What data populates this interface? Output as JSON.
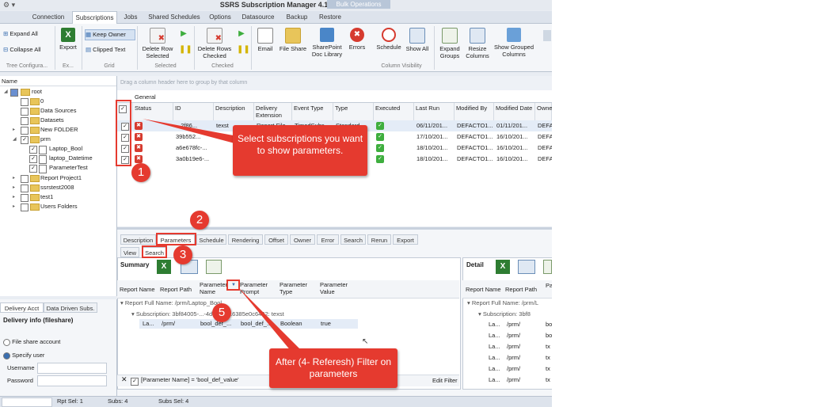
{
  "window": {
    "title": "SSRS Subscription Manager 4.10",
    "bulk_label": "Bulk Operations",
    "icon": "app-icon"
  },
  "menu_tabs": [
    "Connection",
    "Subscriptions",
    "Jobs",
    "Shared Schedules",
    "Options",
    "Datasource",
    "Backup",
    "Restore"
  ],
  "ribbon": {
    "expand_all": "Expand All",
    "collapse_all": "Collapse All",
    "tree_group": "Tree Configura...",
    "export": "Export",
    "export_group": "Ex...",
    "keep_owner": "Keep Owner",
    "clipped_text": "Clipped Text",
    "grid_group": "Grid",
    "delete_row_selected": "Delete Row Selected",
    "selected_group": "Selected",
    "delete_rows_checked": "Delete Rows Checked",
    "checked_group": "Checked",
    "email": "Email",
    "file_share": "File Share",
    "sharepoint": "SharePoint Doc Library",
    "errors": "Errors",
    "schedule": "Schedule",
    "show_all": "Show All",
    "expand_groups": "Expand Groups",
    "resize_columns": "Resize Columns",
    "show_grouped_columns": "Show Grouped Columns",
    "column_visibility_group": "Column Visibility"
  },
  "tree": {
    "header": "Name",
    "items": [
      {
        "label": "root",
        "checked": false
      },
      {
        "label": "0",
        "checked": false
      },
      {
        "label": "Data Sources",
        "checked": false
      },
      {
        "label": "Datasets",
        "checked": false
      },
      {
        "label": "New FOLDER",
        "checked": false
      },
      {
        "label": "prm",
        "checked": true
      },
      {
        "label": "Laptop_Bool",
        "checked": true
      },
      {
        "label": "laptop_Datetime",
        "checked": true
      },
      {
        "label": "ParameterTest",
        "checked": true
      },
      {
        "label": "Report Project1",
        "checked": false
      },
      {
        "label": "ssrstest2008",
        "checked": false
      },
      {
        "label": "test1",
        "checked": false
      },
      {
        "label": "Users Folders",
        "checked": false
      }
    ]
  },
  "delivery": {
    "tab1": "Delivery Acct",
    "tab2": "Data Driven Subs.",
    "title": "Delivery info (fileshare)",
    "opt_file_share": "File share account",
    "opt_specify_user": "Specify user",
    "username_label": "Username",
    "password_label": "Password"
  },
  "grid": {
    "drag_hint": "Drag a column header here to group by that column",
    "band": "General",
    "columns": [
      "Status",
      "ID",
      "Description",
      "Delivery Extension",
      "Event Type",
      "Type",
      "Executed",
      "Last Run",
      "Modified By",
      "Modified Date",
      "Owne"
    ],
    "rows": [
      {
        "id": "...2f86...",
        "description": "texst",
        "delivery": "Report File...",
        "event": "TimedSubs...",
        "type": "Standard",
        "last_run": "06/11/201...",
        "modified_by": "DEFACTO1...",
        "modified_date": "01/11/201...",
        "owner": "DEFA"
      },
      {
        "id": "39b552...",
        "description": "",
        "delivery": "",
        "event": "",
        "type": "",
        "last_run": "17/10/201...",
        "modified_by": "DEFACTO1...",
        "modified_date": "16/10/201...",
        "owner": "DEFA"
      },
      {
        "id": "a6e678fc-...",
        "description": "",
        "delivery": "",
        "event": "",
        "type": "",
        "last_run": "18/10/201...",
        "modified_by": "DEFACTO1...",
        "modified_date": "16/10/201...",
        "owner": "DEFA"
      },
      {
        "id": "3a0b19e6-...",
        "description": "",
        "delivery": "",
        "event": "",
        "type": "",
        "last_run": "18/10/201...",
        "modified_by": "DEFACTO1...",
        "modified_date": "16/10/201...",
        "owner": "DEFA"
      }
    ]
  },
  "detail_tabs": [
    "Description",
    "Parameters",
    "Schedule",
    "Rendering",
    "Offset",
    "Owner",
    "Error",
    "Search",
    "Rerun",
    "Export"
  ],
  "sub_tabs": [
    "View",
    "Search"
  ],
  "summary": {
    "title": "Summary",
    "columns": [
      "Report Name",
      "Report Path",
      "Parameter Name",
      "Parameter Prompt",
      "Parameter Type",
      "Parameter Value"
    ],
    "group_full_name": "Report Full Name: /prm/Laptop_Bool",
    "group_subscription": "Subscription: 3bf84005-...-4d4d-8c...6385e0c6432: texst",
    "row": {
      "name": "La...",
      "path": "/prm/",
      "param": "bool_def_...",
      "prompt": "bool_def_...",
      "type": "Boolean",
      "value": "true"
    },
    "filter_text": "[Parameter Name] = 'bool_def_value'",
    "edit_filter": "Edit Filter"
  },
  "detail": {
    "title": "Detail",
    "columns": [
      "Report Name",
      "Report Path",
      "Pa"
    ],
    "group_full_name": "Report Full Name: /prm/L",
    "group_subscription": "Subscription: 3bf8",
    "rows": [
      {
        "name": "La...",
        "path": "/prm/",
        "p": "bo"
      },
      {
        "name": "La...",
        "path": "/prm/",
        "p": "bo"
      },
      {
        "name": "La...",
        "path": "/prm/",
        "p": "tx"
      },
      {
        "name": "La...",
        "path": "/prm/",
        "p": "tx"
      },
      {
        "name": "La...",
        "path": "/prm/",
        "p": "tx"
      },
      {
        "name": "La...",
        "path": "/prm/",
        "p": "tx"
      }
    ]
  },
  "status_bar": {
    "rpt_sel": "Rpt Sel: 1",
    "subs": "Subs: 4",
    "subs_sel": "Subs Sel: 4"
  },
  "annotations": {
    "callout1": "Select subscriptions you want to show parameters.",
    "callout2": "After (4- Referesh) Filter on parameters",
    "badges": [
      "1",
      "2",
      "3",
      "5"
    ]
  },
  "colors": {
    "accent_red": "#e53a2f",
    "status_error": "#d63b2f",
    "status_ok": "#3eae3e",
    "folder": "#e8c55a"
  }
}
